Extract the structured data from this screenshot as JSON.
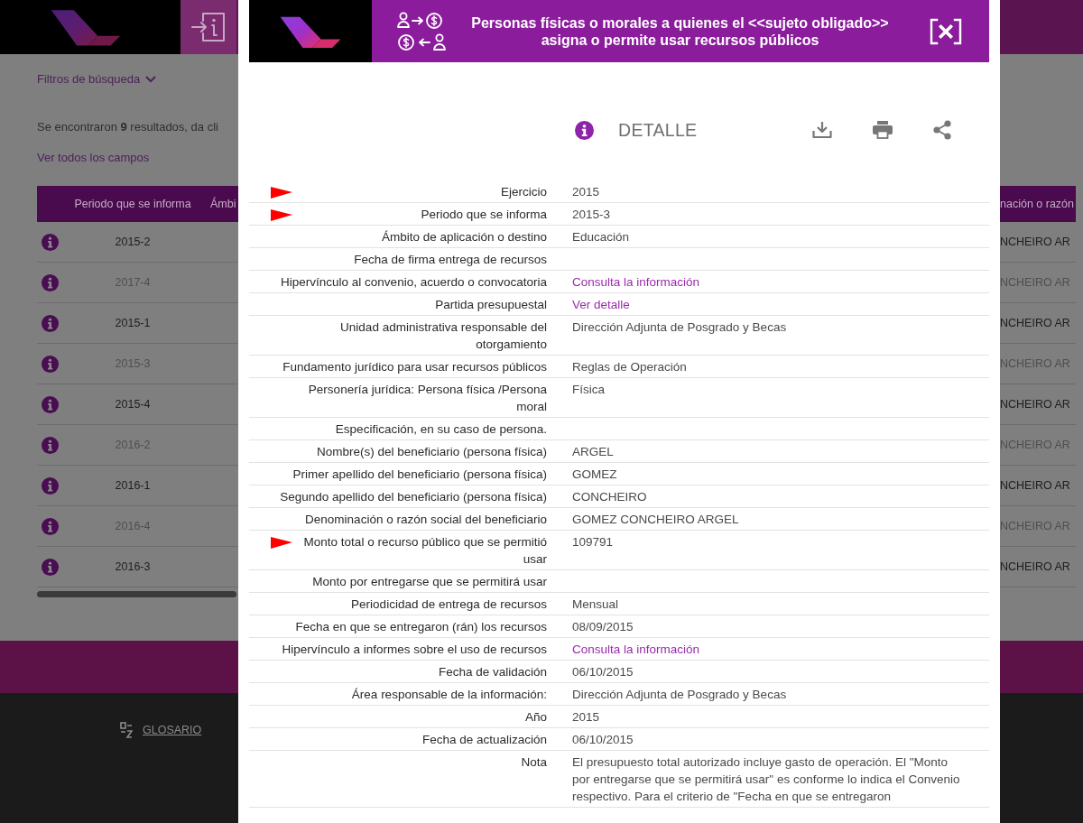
{
  "background_page": {
    "filters_toggle": "Filtros de búsqueda",
    "results_text": "Se encontraron **9** resultados, da cli",
    "view_all_link": "Ver todos los campos",
    "table": {
      "columns": [
        "Periodo que se informa",
        "Ámbi",
        "nación o razón"
      ],
      "rows": [
        {
          "period": "2015-2",
          "column_3": "NCHEIRO AR"
        },
        {
          "period": "2017-4",
          "column_3": "NCHEIRO AR"
        },
        {
          "period": "2015-1",
          "column_3": "NCHEIRO AR"
        },
        {
          "period": "2015-3",
          "column_3": "NCHEIRO AR"
        },
        {
          "period": "2015-4",
          "column_3": "NCHEIRO AR"
        },
        {
          "period": "2016-2",
          "column_3": "NCHEIRO AR"
        },
        {
          "period": "2016-1",
          "column_3": "NCHEIRO AR"
        },
        {
          "period": "2016-4",
          "column_3": "NCHEIRO AR"
        },
        {
          "period": "2016-3",
          "column_3": "NCHEIRO AR"
        }
      ]
    },
    "footer": {
      "glossary_link": "GLOSARIO"
    }
  },
  "modal": {
    "title": "Personas físicas o morales a quienes el <<sujeto obligado>> asigna o permite usar recursos públicos",
    "section_title": "DETALLE",
    "fields": [
      {
        "label": "Ejercicio",
        "kind": "text",
        "value": "2015",
        "flagged": true
      },
      {
        "label": "Periodo que se informa",
        "kind": "text",
        "value": "2015-3",
        "flagged": true
      },
      {
        "label": "Ámbito de aplicación o destino",
        "kind": "text",
        "value": "Educación",
        "flagged": false
      },
      {
        "label": "Fecha de firma entrega de recursos",
        "kind": "empty",
        "flagged": false
      },
      {
        "label": "Hipervínculo al convenio, acuerdo o convocatoria",
        "kind": "link",
        "value": "Consulta la información",
        "flagged": false
      },
      {
        "label": "Partida presupuestal",
        "kind": "link",
        "value": "Ver detalle",
        "flagged": false
      },
      {
        "label": "Unidad administrativa responsable del otorgamiento",
        "kind": "text",
        "value": "Dirección Adjunta de Posgrado y Becas",
        "flagged": false
      },
      {
        "label": "Fundamento jurídico para usar recursos públicos",
        "kind": "text",
        "value": "Reglas de Operación",
        "flagged": false
      },
      {
        "label": "Personería jurídica: Persona física /Persona moral",
        "kind": "text",
        "value": "Física",
        "flagged": false
      },
      {
        "label": "Especificación, en su caso de persona.",
        "kind": "empty",
        "flagged": false
      },
      {
        "label": "Nombre(s) del beneficiario (persona física)",
        "kind": "text",
        "value": "ARGEL",
        "flagged": false
      },
      {
        "label": "Primer apellido del beneficiario (persona física)",
        "kind": "text",
        "value": "GOMEZ",
        "flagged": false
      },
      {
        "label": "Segundo apellido del beneficiario (persona física)",
        "kind": "text",
        "value": "CONCHEIRO",
        "flagged": false
      },
      {
        "label": "Denominación o razón social del beneficiario",
        "kind": "text",
        "value": "GOMEZ CONCHEIRO ARGEL",
        "flagged": false
      },
      {
        "label": "Monto total o recurso público que se permitió usar",
        "kind": "text",
        "value": "109791",
        "flagged": true
      },
      {
        "label": "Monto por entregarse que se permitirá usar",
        "kind": "empty",
        "flagged": false
      },
      {
        "label": "Periodicidad de entrega de recursos",
        "kind": "text",
        "value": "Mensual",
        "flagged": false
      },
      {
        "label": "Fecha en que se entregaron (rán) los recursos",
        "kind": "text",
        "value": "08/09/2015",
        "flagged": false
      },
      {
        "label": "Hipervínculo a informes sobre el uso de recursos",
        "kind": "link",
        "value": "Consulta la información",
        "flagged": false
      },
      {
        "label": "Fecha de validación",
        "kind": "text",
        "value": "06/10/2015",
        "flagged": false
      },
      {
        "label": "Área responsable de la información:",
        "kind": "text",
        "value": "Dirección Adjunta de Posgrado y Becas",
        "flagged": false
      },
      {
        "label": "Año",
        "kind": "text",
        "value": "2015",
        "flagged": false
      },
      {
        "label": "Fecha de actualización",
        "kind": "text",
        "value": "06/10/2015",
        "flagged": false
      },
      {
        "label": "Nota",
        "kind": "text",
        "value": "El presupuesto total autorizado incluye gasto de operación. El \"Monto por entregarse que se permitirá usar\" es conforme lo indica el Convenio respectivo. Para el criterio de \"Fecha en que se entregaron",
        "flagged": false
      }
    ]
  }
}
